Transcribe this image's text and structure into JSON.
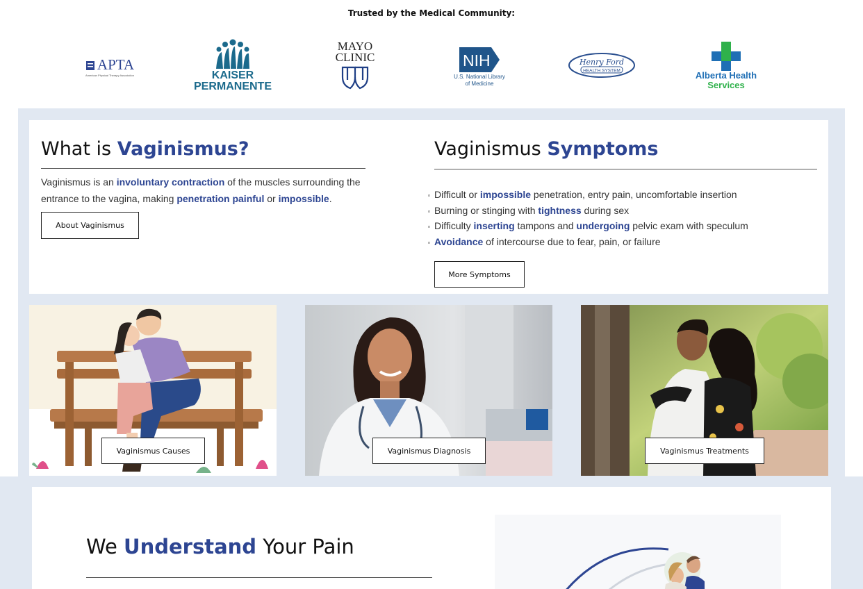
{
  "trusted": {
    "label": "Trusted by the Medical Community:"
  },
  "logos": {
    "apta": {
      "name": "APTA",
      "sub": "American Physical Therapy Association"
    },
    "kaiser": {
      "line1": "KAISER",
      "line2": "PERMANENTE"
    },
    "mayo": {
      "line1": "MAYO",
      "line2": "CLINIC"
    },
    "nih": {
      "name": "NIH",
      "line1": "U.S. National Library",
      "line2": "of Medicine"
    },
    "henryford": {
      "line1": "Henry Ford",
      "line2": "HEALTH SYSTEM"
    },
    "alberta": {
      "line1": "Alberta Health",
      "line2": "Services"
    }
  },
  "what": {
    "title_pre": "What is ",
    "title_hl": "Vaginismus?",
    "p1": "Vaginismus is an ",
    "p1_b": "involuntary contraction",
    "p2": " of the muscles surrounding the entrance to the vagina, making ",
    "p2_b": "penetration painful",
    "p3": " or ",
    "p3_b": "impossible",
    "p4": ".",
    "button": "About Vaginismus"
  },
  "symptoms": {
    "title_pre": "Vaginismus ",
    "title_hl": "Symptoms",
    "items": [
      {
        "a": "Difficult or ",
        "b": "impossible",
        "c": " penetration, entry pain, uncomfortable insertion"
      },
      {
        "a": "Burning or stinging with ",
        "b": "tightness",
        "c": " during sex"
      },
      {
        "a": "Difficulty ",
        "b": "inserting",
        "c": " tampons and ",
        "d": "undergoing",
        "e": " pelvic exam with speculum"
      },
      {
        "a": "",
        "b": "Avoidance",
        "c": " of intercourse due to fear, pain, or failure"
      }
    ],
    "button": "More Symptoms"
  },
  "cards": [
    {
      "label": "Vaginismus Causes"
    },
    {
      "label": "Vaginismus Diagnosis"
    },
    {
      "label": "Vaginismus Treatments"
    }
  ],
  "understand": {
    "pre": "We ",
    "hl": "Understand",
    "post": " Your Pain"
  },
  "colors": {
    "accent": "#2d4592",
    "band": "#e1e8f2"
  }
}
